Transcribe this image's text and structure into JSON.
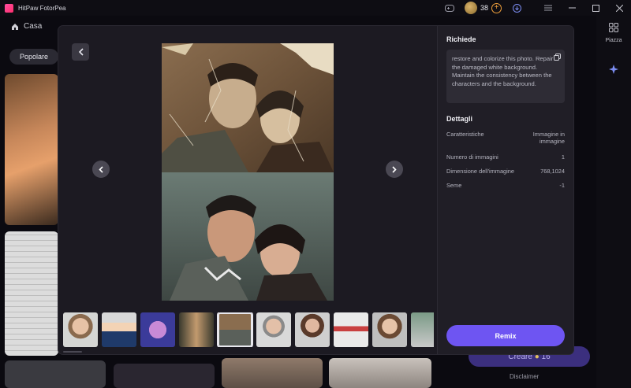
{
  "app": {
    "title": "HitPaw FotorPea",
    "credits": "38"
  },
  "background": {
    "home_label": "Casa",
    "popular_chip": "Popolare",
    "rail_label": "Piazza",
    "create_label": "Creare",
    "create_cost": "16",
    "disclaimer": "Disclaimer"
  },
  "modal": {
    "prompt_heading": "Richiede",
    "prompt_text": "restore and colorize this photo. Repair the damaged white background. Maintain the consistency between the characters and the background.",
    "details_heading": "Dettagli",
    "details": [
      {
        "label": "Caratteristiche",
        "value": "Immagine in immagine"
      },
      {
        "label": "Numero di immagini",
        "value": "1"
      },
      {
        "label": "Dimensione dell'immagine",
        "value": "768,1024"
      },
      {
        "label": "Seme",
        "value": "-1"
      }
    ],
    "remix_label": "Remix"
  },
  "icons": {
    "back": "chevron-left-icon",
    "prev": "chevron-left-icon",
    "next": "chevron-right-icon",
    "copy": "copy-icon"
  },
  "colors": {
    "accent": "#6e55f2",
    "modal_bg": "#1c1a22",
    "panel_bg": "#201e26"
  }
}
